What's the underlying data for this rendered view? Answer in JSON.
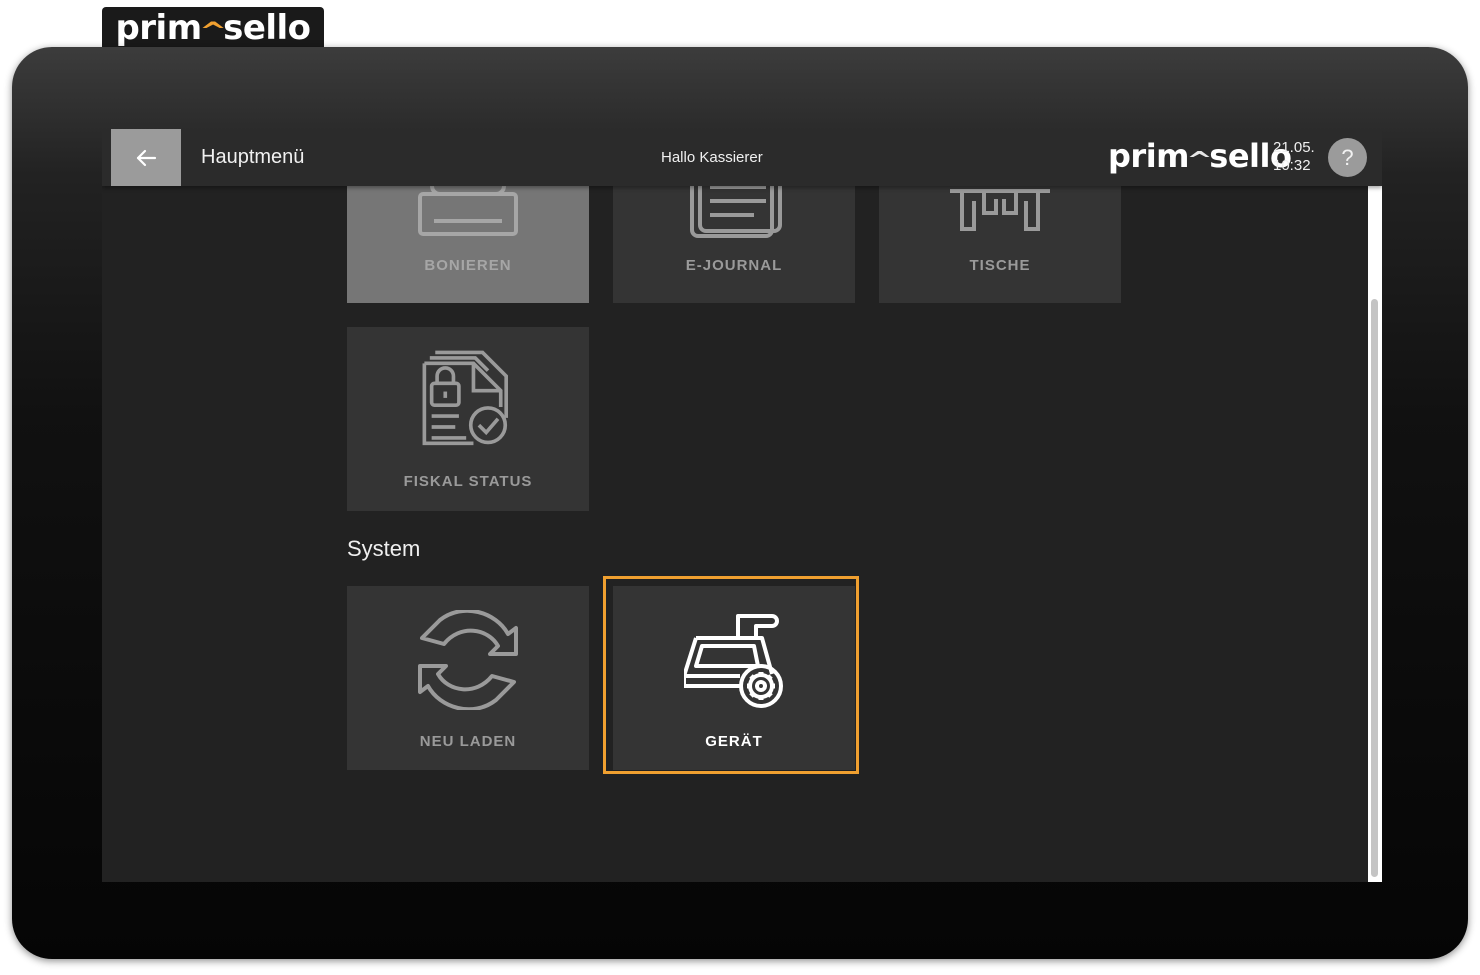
{
  "brand": {
    "logo_left": "prim",
    "logo_mark": "^",
    "logo_right": "sello"
  },
  "header": {
    "title": "Hauptmenü",
    "greeting": "Hallo Kassierer",
    "date": "21.05.",
    "time": "10:32",
    "help_label": "?"
  },
  "tiles_top": [
    {
      "label": "BONIEREN",
      "icon": "cash-register-icon"
    },
    {
      "label": "E-JOURNAL",
      "icon": "journal-icon"
    },
    {
      "label": "TISCHE",
      "icon": "tables-icon"
    }
  ],
  "tiles_mid": [
    {
      "label": "FISKAL STATUS",
      "icon": "fiscal-document-icon"
    }
  ],
  "system": {
    "title": "System",
    "tiles": [
      {
        "label": "NEU LADEN",
        "icon": "reload-icon"
      },
      {
        "label": "GERÄT",
        "icon": "device-settings-icon",
        "selected": true
      }
    ]
  },
  "colors": {
    "accent": "#f0a030",
    "background": "#222222",
    "tile": "#343434",
    "button": "#9b9b9b"
  }
}
